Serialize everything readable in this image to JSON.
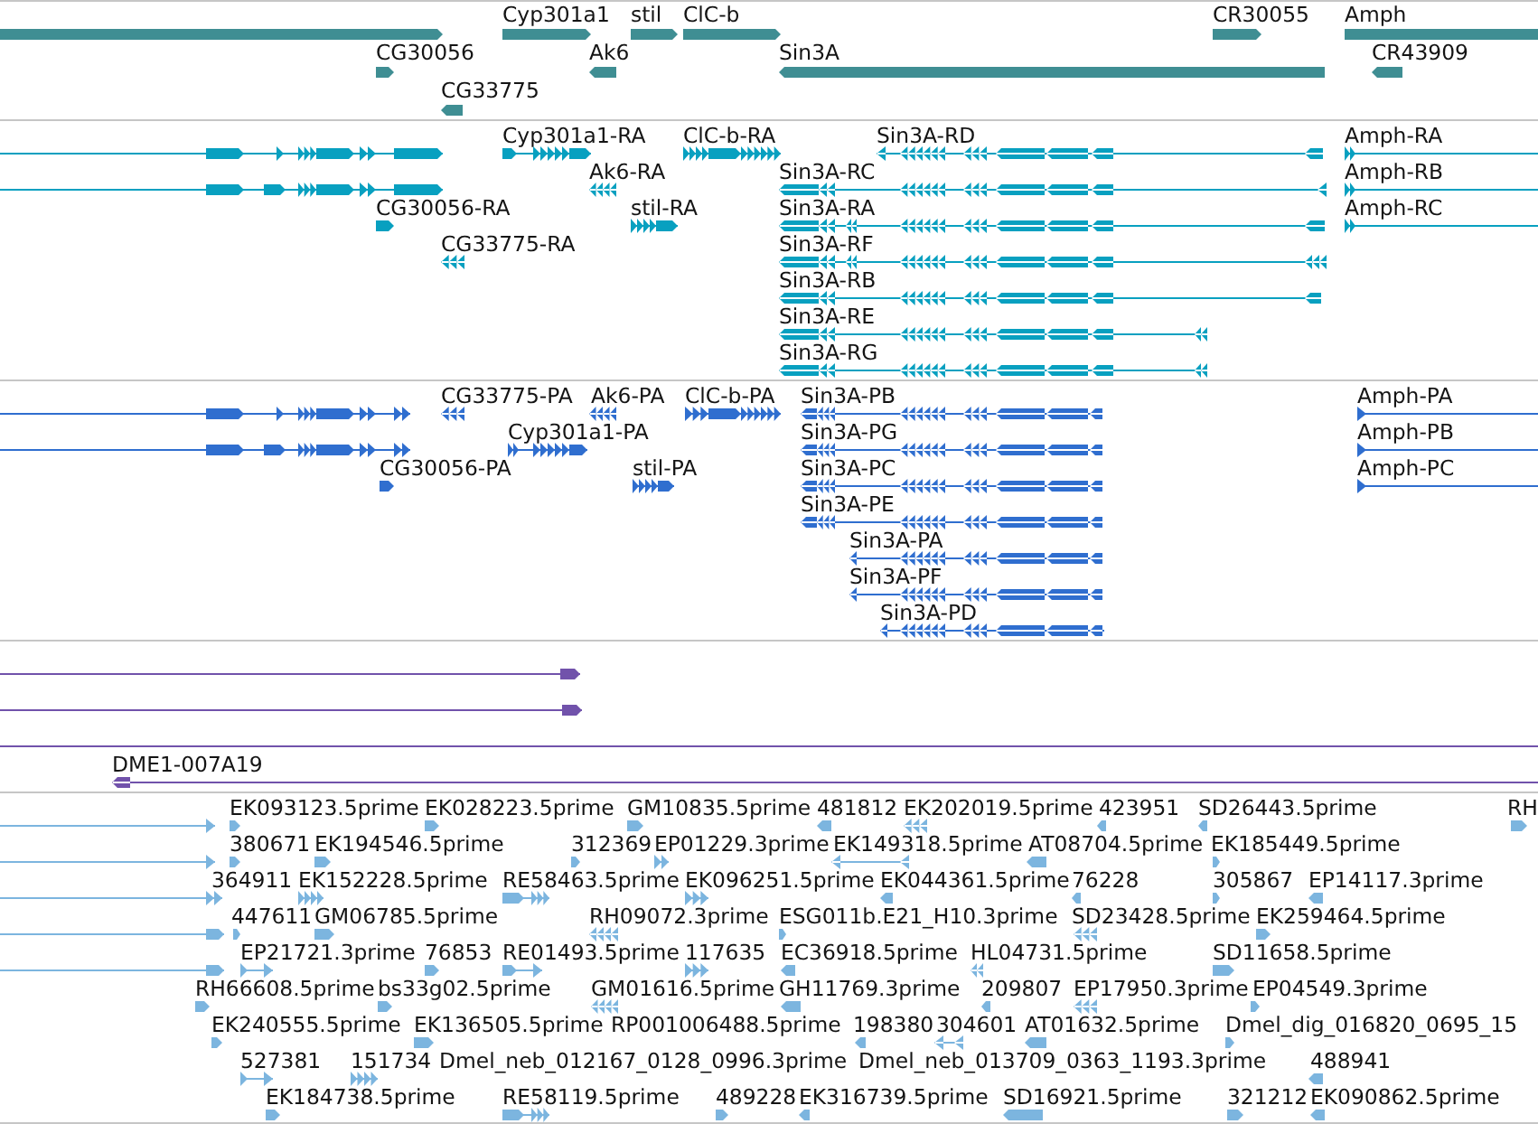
{
  "tracks": [
    {
      "kind": "gene",
      "rows": [
        {
          "features": [
            {
              "reverse": false,
              "selected": false
            },
            {
              "label": "Cyp301a1",
              "reverse": false,
              "selected": false
            },
            {
              "label": "stil",
              "reverse": false,
              "selected": false
            },
            {
              "label": "ClC-b",
              "reverse": false,
              "selected": false
            },
            {
              "label": "CR30055",
              "reverse": false,
              "selected": false
            },
            {
              "label": "Amph",
              "selected": false
            }
          ]
        },
        {
          "features": [
            {
              "label": "CG30056",
              "reverse": false,
              "selected": false
            },
            {
              "label": "Ak6",
              "reverse": true,
              "selected": false
            },
            {
              "label": "Sin3A",
              "reverse": true,
              "selected": false
            },
            {
              "label": "CR43909",
              "reverse": true,
              "selected": false
            }
          ]
        },
        {
          "features": [
            {
              "label": "CG33775",
              "reverse": true,
              "selected": false
            }
          ]
        }
      ]
    },
    {
      "kind": "transcript",
      "rows": [
        {
          "features": [
            {
              "reverse": false,
              "selected": false
            },
            {
              "label": "Cyp301a1-RA",
              "reverse": false,
              "selected": false
            },
            {
              "label": "ClC-b-RA",
              "reverse": false,
              "selected": false
            },
            {
              "label": "Sin3A-RD",
              "reverse": true,
              "selected": false
            },
            {
              "label": "Amph-RA",
              "reverse": false,
              "selected": false
            }
          ]
        },
        {
          "features": [
            {
              "reverse": false,
              "selected": false
            },
            {
              "label": "Ak6-RA",
              "reverse": true,
              "selected": false
            },
            {
              "label": "Sin3A-RC",
              "reverse": true,
              "selected": false
            },
            {
              "label": "Amph-RB",
              "reverse": false,
              "selected": false
            }
          ]
        },
        {
          "features": [
            {
              "label": "CG30056-RA",
              "reverse": false,
              "selected": false
            },
            {
              "label": "stil-RA",
              "reverse": false,
              "selected": false
            },
            {
              "label": "Sin3A-RA",
              "reverse": true,
              "selected": false
            },
            {
              "label": "Amph-RC",
              "reverse": false,
              "selected": false
            }
          ]
        },
        {
          "features": [
            {
              "label": "CG33775-RA",
              "reverse": true,
              "selected": false
            },
            {
              "label": "Sin3A-RF",
              "reverse": true,
              "selected": false
            }
          ]
        },
        {
          "features": [
            {
              "label": "Sin3A-RB",
              "reverse": true,
              "selected": false
            }
          ]
        },
        {
          "features": [
            {
              "label": "Sin3A-RE",
              "reverse": true,
              "selected": false
            }
          ]
        },
        {
          "features": [
            {
              "label": "Sin3A-RG",
              "reverse": true,
              "selected": false
            }
          ]
        }
      ]
    },
    {
      "kind": "protein",
      "rows": [
        {
          "features": [
            {
              "reverse": false,
              "selected": false
            },
            {
              "label": "CG33775-PA",
              "reverse": true,
              "selected": false
            },
            {
              "label": "Ak6-PA",
              "reverse": true,
              "selected": false
            },
            {
              "label": "ClC-b-PA",
              "reverse": false,
              "selected": false
            },
            {
              "label": "Sin3A-PB",
              "reverse": true,
              "selected": false
            },
            {
              "label": "Amph-PA",
              "reverse": false,
              "selected": false
            }
          ]
        },
        {
          "features": [
            {
              "reverse": false,
              "selected": false
            },
            {
              "label": "Cyp301a1-PA",
              "reverse": false,
              "selected": false
            },
            {
              "label": "Sin3A-PG",
              "reverse": true,
              "selected": false
            },
            {
              "label": "Amph-PB",
              "reverse": false,
              "selected": false
            }
          ]
        },
        {
          "features": [
            {
              "label": "CG30056-PA",
              "reverse": false,
              "selected": false
            },
            {
              "label": "stil-PA",
              "reverse": false,
              "selected": false
            },
            {
              "label": "Sin3A-PC",
              "reverse": true,
              "selected": false
            },
            {
              "label": "Amph-PC",
              "reverse": false,
              "selected": false
            }
          ]
        },
        {
          "features": [
            {
              "label": "Sin3A-PE",
              "reverse": true,
              "selected": false
            }
          ]
        },
        {
          "features": [
            {
              "label": "Sin3A-PA",
              "reverse": true,
              "selected": false
            }
          ]
        },
        {
          "features": [
            {
              "label": "Sin3A-PF",
              "reverse": true,
              "selected": false
            }
          ]
        },
        {
          "features": [
            {
              "label": "Sin3A-PD",
              "reverse": true,
              "selected": false
            }
          ]
        }
      ]
    },
    {
      "kind": "clone",
      "rows": [
        {
          "features": [
            {
              "reverse": false,
              "selected": false
            }
          ]
        },
        {
          "features": [
            {
              "reverse": false,
              "selected": false
            }
          ]
        },
        {
          "features": [
            {
              "selected": false
            }
          ]
        },
        {
          "features": [
            {
              "label": "DME1-007A19",
              "reverse": true,
              "selected": false
            }
          ]
        }
      ]
    },
    {
      "kind": "est",
      "rows": [
        {
          "features": [
            {
              "reverse": false,
              "selected": false
            },
            {
              "label": "EK093123.5prime",
              "reverse": false,
              "selected": false
            },
            {
              "label": "EK028223.5prime",
              "reverse": false,
              "selected": false
            },
            {
              "label": "GM10835.5prime",
              "reverse": false,
              "selected": false
            },
            {
              "label": "481812",
              "reverse": true,
              "selected": false
            },
            {
              "label": "EK202019.5prime",
              "reverse": true,
              "selected": false
            },
            {
              "label": "423951",
              "reverse": true,
              "selected": false
            },
            {
              "label": "SD26443.5prime",
              "reverse": true,
              "selected": false
            },
            {
              "label": "RH",
              "reverse": false,
              "selected": false
            }
          ]
        },
        {
          "features": [
            {
              "reverse": false,
              "selected": false
            },
            {
              "label": "380671",
              "reverse": false,
              "selected": false
            },
            {
              "label": "EK194546.5prime",
              "reverse": false,
              "selected": false
            },
            {
              "label": "312369",
              "reverse": false,
              "selected": false
            },
            {
              "label": "EP01229.3prime",
              "reverse": false,
              "selected": false
            },
            {
              "label": "EK149318.5prime",
              "reverse": true,
              "selected": false
            },
            {
              "label": "AT08704.5prime",
              "reverse": true,
              "selected": false
            },
            {
              "label": "EK185449.5prime",
              "reverse": false,
              "selected": false
            }
          ]
        },
        {
          "features": [
            {
              "reverse": false,
              "selected": false
            },
            {
              "label": "364911",
              "selected": false
            },
            {
              "label": "EK152228.5prime",
              "reverse": false,
              "selected": false
            },
            {
              "label": "RE58463.5prime",
              "reverse": false,
              "selected": false
            },
            {
              "label": "EK096251.5prime",
              "reverse": false,
              "selected": false
            },
            {
              "label": "EK044361.5prime",
              "reverse": true,
              "selected": false
            },
            {
              "label": "76228",
              "reverse": true,
              "selected": false
            },
            {
              "label": "305867",
              "reverse": false,
              "selected": false
            },
            {
              "label": "EP14117.3prime",
              "reverse": true,
              "selected": false
            }
          ]
        },
        {
          "features": [
            {
              "reverse": false,
              "selected": false
            },
            {
              "label": "447611",
              "reverse": false,
              "selected": false
            },
            {
              "label": "GM06785.5prime",
              "reverse": false,
              "selected": false
            },
            {
              "label": "RH09072.3prime",
              "reverse": true,
              "selected": false
            },
            {
              "label": "ESG011b.E21_H10.3prime",
              "reverse": false,
              "selected": false
            },
            {
              "label": "SD23428.5prime",
              "reverse": true,
              "selected": false
            },
            {
              "label": "EK259464.5prime",
              "reverse": false,
              "selected": false
            }
          ]
        },
        {
          "features": [
            {
              "reverse": false,
              "selected": false
            },
            {
              "label": "EP21721.3prime",
              "reverse": false,
              "selected": false
            },
            {
              "label": "76853",
              "reverse": false,
              "selected": false
            },
            {
              "label": "RE01493.5prime",
              "reverse": false,
              "selected": false
            },
            {
              "label": "117635",
              "reverse": false,
              "selected": false
            },
            {
              "label": "EC36918.5prime",
              "reverse": true,
              "selected": false
            },
            {
              "label": "HL04731.5prime",
              "reverse": true,
              "selected": false
            },
            {
              "label": "SD11658.5prime",
              "reverse": false,
              "selected": false
            }
          ]
        },
        {
          "features": [
            {
              "label": "RH66608.5prime",
              "reverse": false,
              "selected": false
            },
            {
              "label": "bs33g02.5prime",
              "reverse": false,
              "selected": false
            },
            {
              "label": "GM01616.5prime",
              "reverse": true,
              "selected": false
            },
            {
              "label": "GH11769.3prime",
              "reverse": true,
              "selected": false
            },
            {
              "label": "209807",
              "reverse": true,
              "selected": false
            },
            {
              "label": "EP17950.3prime",
              "reverse": true,
              "selected": false
            },
            {
              "label": "EP04549.3prime",
              "reverse": false,
              "selected": false
            }
          ]
        },
        {
          "features": [
            {
              "label": "EK240555.5prime",
              "reverse": false,
              "selected": false
            },
            {
              "label": "EK136505.5prime",
              "reverse": false,
              "selected": false
            },
            {
              "label": "RP001006488.5prime",
              "selected": false
            },
            {
              "label": "198380",
              "reverse": true,
              "selected": false
            },
            {
              "label": "304601",
              "reverse": true,
              "selected": false
            },
            {
              "label": "AT01632.5prime",
              "reverse": true,
              "selected": false
            },
            {
              "label": "Dmel_dig_016820_0695_15",
              "reverse": false,
              "selected": false
            }
          ]
        },
        {
          "features": [
            {
              "label": "527381",
              "reverse": false,
              "selected": false
            },
            {
              "label": "151734",
              "reverse": false,
              "selected": false
            },
            {
              "label": "Dmel_neb_012167_0128_0996.3prime",
              "selected": false
            },
            {
              "label": "Dmel_neb_013709_0363_1193.3prime",
              "selected": false
            },
            {
              "label": "488941",
              "reverse": true,
              "selected": false
            }
          ]
        },
        {
          "features": [
            {
              "label": "EK184738.5prime",
              "reverse": false,
              "selected": false
            },
            {
              "label": "RE58119.5prime",
              "reverse": false,
              "selected": false
            },
            {
              "label": "489228",
              "reverse": false,
              "selected": false
            },
            {
              "label": "EK316739.5prime",
              "reverse": true,
              "selected": false
            },
            {
              "label": "SD16921.5prime",
              "reverse": true,
              "selected": false
            },
            {
              "label": "321212",
              "reverse": false,
              "selected": false
            },
            {
              "label": "EK090862.5prime",
              "reverse": true,
              "selected": false
            }
          ]
        }
      ]
    }
  ]
}
